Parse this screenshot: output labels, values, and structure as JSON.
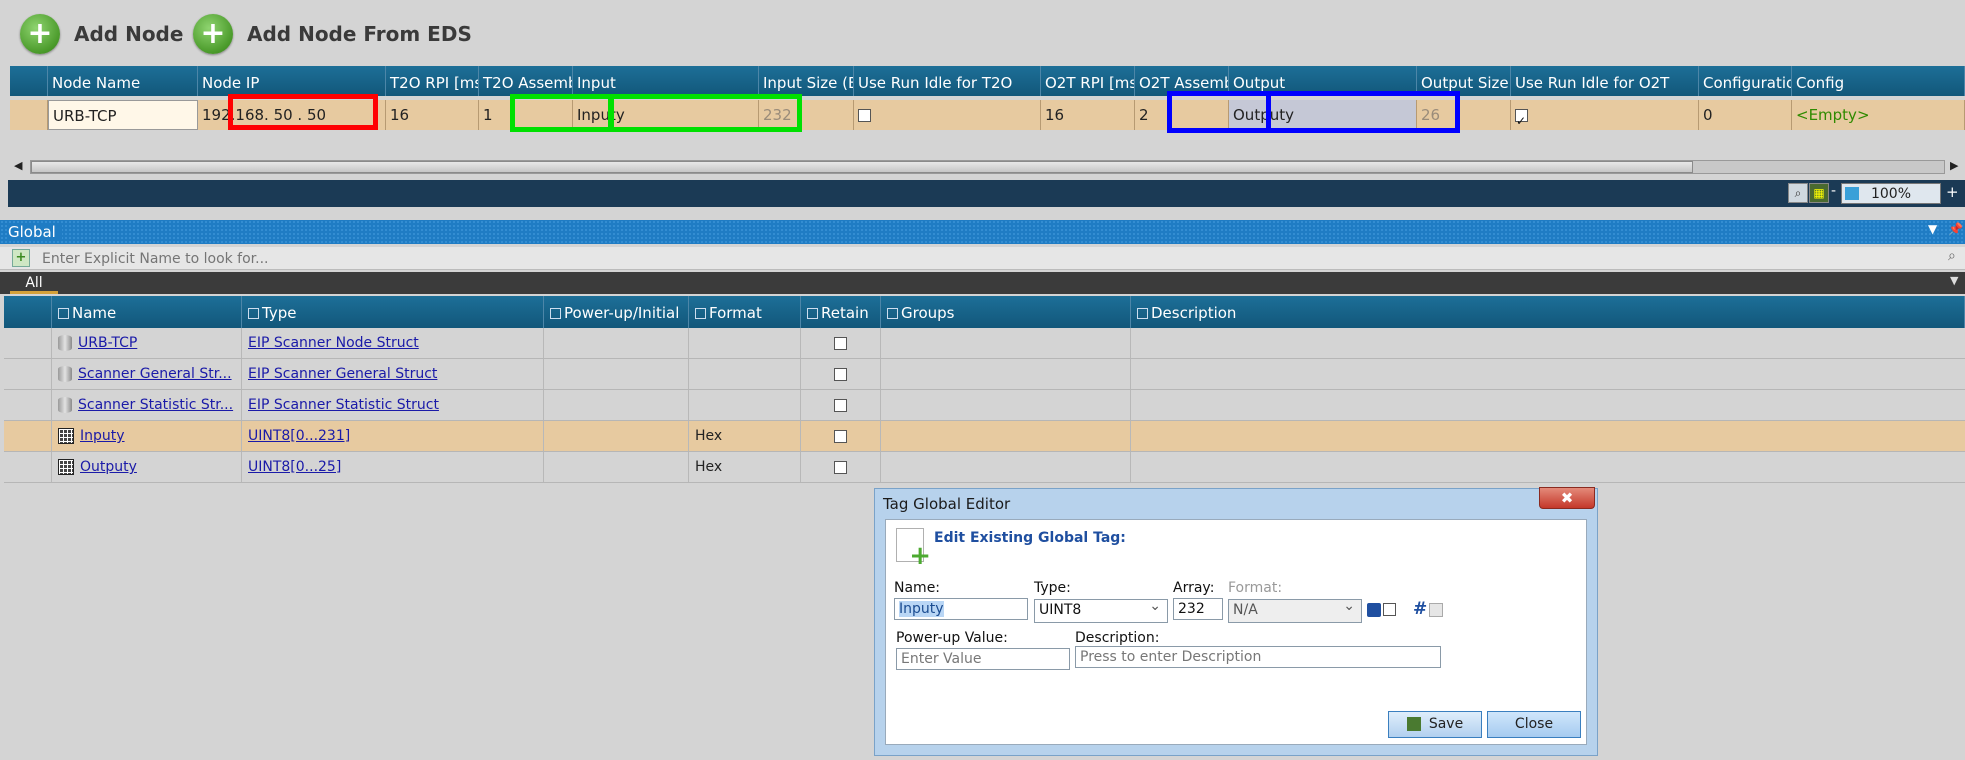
{
  "toolbar": {
    "add_node": "Add Node",
    "add_node_from_eds": "Add Node From EDS"
  },
  "node_grid": {
    "headers": [
      "Node Name",
      "Node IP",
      "T2O RPI [ms]",
      "T2O Assemb",
      "Input",
      "Input Size (B",
      "Use Run Idle for T2O",
      "O2T RPI [ms]",
      "O2T Assemb",
      "Output",
      "Output Size (",
      "Use Run Idle for O2T",
      "Configuratio",
      "Config"
    ],
    "row": {
      "node_name": "URB-TCP",
      "node_ip": "192.168. 50 . 50",
      "t2o_rpi": "16",
      "t2o_assembly": "1",
      "input": "Inputy",
      "input_size": "232",
      "use_run_idle_t2o": false,
      "o2t_rpi": "16",
      "o2t_assembly": "2",
      "output": "Outputy",
      "output_size": "26",
      "use_run_idle_o2t": true,
      "configuration": "0",
      "config": "<Empty>"
    },
    "highlight_colors": {
      "red": "#ff0000",
      "green": "#00e000",
      "blue": "#0000ff"
    }
  },
  "zoom": {
    "value": "100%"
  },
  "global_panel": {
    "title": "Global",
    "search_placeholder": "Enter Explicit Name to look for...",
    "tab": "All",
    "columns": [
      "Name",
      "Type",
      "Power-up/Initial",
      "Format",
      "Retain",
      "Groups",
      "Description"
    ],
    "rows": [
      {
        "name": "URB-TCP",
        "type": "EIP Scanner Node Struct",
        "format": "",
        "icon": "struct-icon",
        "selected": false
      },
      {
        "name": "Scanner General Str...",
        "type": "EIP Scanner General Struct",
        "format": "",
        "icon": "struct-icon",
        "selected": false
      },
      {
        "name": "Scanner Statistic Str...",
        "type": "EIP Scanner Statistic Struct",
        "format": "",
        "icon": "struct-icon",
        "selected": false
      },
      {
        "name": "Inputy",
        "type": "UINT8[0...231]",
        "format": "Hex",
        "icon": "array-icon",
        "selected": true
      },
      {
        "name": "Outputy",
        "type": "UINT8[0...25]",
        "format": "Hex",
        "icon": "array-icon",
        "selected": false
      }
    ]
  },
  "dialog": {
    "title": "Tag Global Editor",
    "heading": "Edit Existing Global Tag:",
    "name_label": "Name:",
    "name_value": "Inputy",
    "type_label": "Type:",
    "type_value": "UINT8",
    "array_label": "Array:",
    "array_value": "232",
    "format_label": "Format:",
    "format_value": "N/A",
    "powerup_label": "Power-up Value:",
    "powerup_placeholder": "Enter Value",
    "description_label": "Description:",
    "description_placeholder": "Press to enter Description",
    "save": "Save",
    "close": "Close",
    "close_glyph": "✖"
  }
}
